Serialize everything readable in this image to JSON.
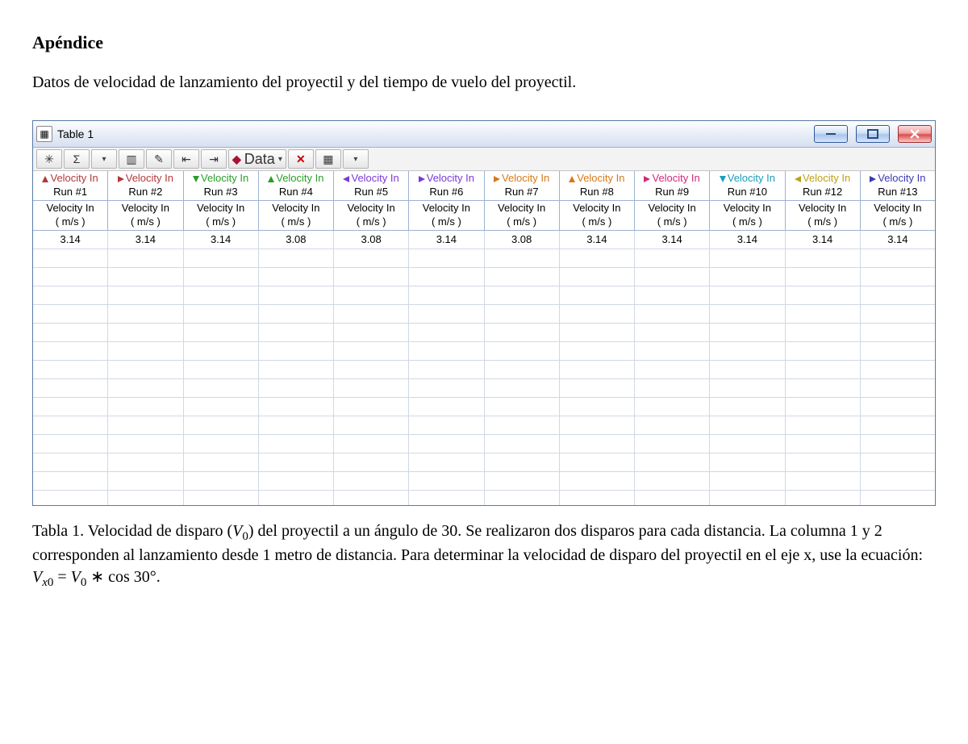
{
  "heading": "Apéndice",
  "intro": "Datos de velocidad de lanzamiento del proyectil y del tiempo de vuelo del proyectil.",
  "window": {
    "title": "Table 1",
    "data_button": "Data"
  },
  "columns": [
    {
      "top": "Velocity In",
      "run": "Run #1",
      "sub1": "Velocity In",
      "sub2": "( m/s )",
      "value": "3.14",
      "color": "#b03a3a",
      "dir": "up"
    },
    {
      "top": "Velocity In",
      "run": "Run #2",
      "sub1": "Velocity In",
      "sub2": "( m/s )",
      "value": "3.14",
      "color": "#b03a3a",
      "dir": "rt"
    },
    {
      "top": "Velocity In",
      "run": "Run #3",
      "sub1": "Velocity In",
      "sub2": "( m/s )",
      "value": "3.14",
      "color": "#2a9d2a",
      "dir": "dn"
    },
    {
      "top": "Velocity In",
      "run": "Run #4",
      "sub1": "Velocity In",
      "sub2": "( m/s )",
      "value": "3.08",
      "color": "#2a9d2a",
      "dir": "up"
    },
    {
      "top": "Velocity In",
      "run": "Run #5",
      "sub1": "Velocity In",
      "sub2": "( m/s )",
      "value": "3.08",
      "color": "#7a3ad6",
      "dir": "lt"
    },
    {
      "top": "Velocity In",
      "run": "Run #6",
      "sub1": "Velocity In",
      "sub2": "( m/s )",
      "value": "3.14",
      "color": "#7a3ad6",
      "dir": "rt"
    },
    {
      "top": "Velocity In",
      "run": "Run #7",
      "sub1": "Velocity In",
      "sub2": "( m/s )",
      "value": "3.08",
      "color": "#d67a1a",
      "dir": "rt"
    },
    {
      "top": "Velocity In",
      "run": "Run #8",
      "sub1": "Velocity In",
      "sub2": "( m/s )",
      "value": "3.14",
      "color": "#d67a1a",
      "dir": "up"
    },
    {
      "top": "Velocity In",
      "run": "Run #9",
      "sub1": "Velocity In",
      "sub2": "( m/s )",
      "value": "3.14",
      "color": "#d12a7a",
      "dir": "rt"
    },
    {
      "top": "Velocity In",
      "run": "Run #10",
      "sub1": "Velocity In",
      "sub2": "( m/s )",
      "value": "3.14",
      "color": "#1a9dbd",
      "dir": "dn"
    },
    {
      "top": "Velocity In",
      "run": "Run #12",
      "sub1": "Velocity In",
      "sub2": "( m/s )",
      "value": "3.14",
      "color": "#bda11a",
      "dir": "lt"
    },
    {
      "top": "Velocity In",
      "run": "Run #13",
      "sub1": "Velocity In",
      "sub2": "( m/s )",
      "value": "3.14",
      "color": "#3a3ab0",
      "dir": "rt"
    }
  ],
  "caption_plain_lines": [
    "Tabla 1. Velocidad de disparo (V₀) del proyectil a un ángulo de 30. Se realizaron dos disparos",
    "para cada distancia. La columna 1 y 2 corresponden al lanzamiento desde 1 metro de distancia.",
    "Para determinar la velocidad de disparo del proyectil en el eje x, use la ecuación:",
    "Vₓ₀ = V₀ ∗ cos 30°."
  ]
}
